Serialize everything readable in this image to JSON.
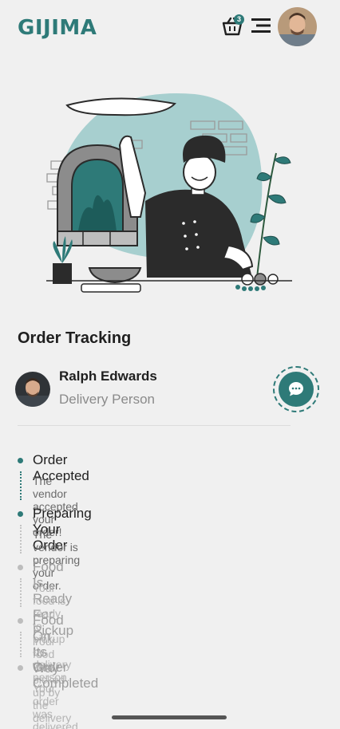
{
  "header": {
    "logo": "GIJIMA",
    "cart_count": "3",
    "icons": [
      "basket-icon",
      "menu-icon"
    ]
  },
  "page": {
    "title": "Order Tracking"
  },
  "courier": {
    "name": "Ralph Edwards",
    "role": "Delivery Person"
  },
  "steps": [
    {
      "title": "Order Accepted",
      "description": "The vendor accepted your order!",
      "completed": true
    },
    {
      "title": "Preparing Your Order",
      "description": "The vendor is preparing your order.",
      "completed": true
    },
    {
      "title": "Food Is Ready For Pickup",
      "description": "Your food is ready to pickup by delivery person.",
      "completed": false
    },
    {
      "title": "Food On Its Way",
      "description": "Your food was picked up by the delivery person.",
      "completed": false
    },
    {
      "title": "Order Completed",
      "description": "Your order was delivered to you.",
      "completed": false
    }
  ],
  "colors": {
    "accent": "#2e7a78",
    "active_text": "#1f1f1f",
    "inactive_text": "#a9a9a9",
    "inactive_dot": "#bdbdbd"
  }
}
